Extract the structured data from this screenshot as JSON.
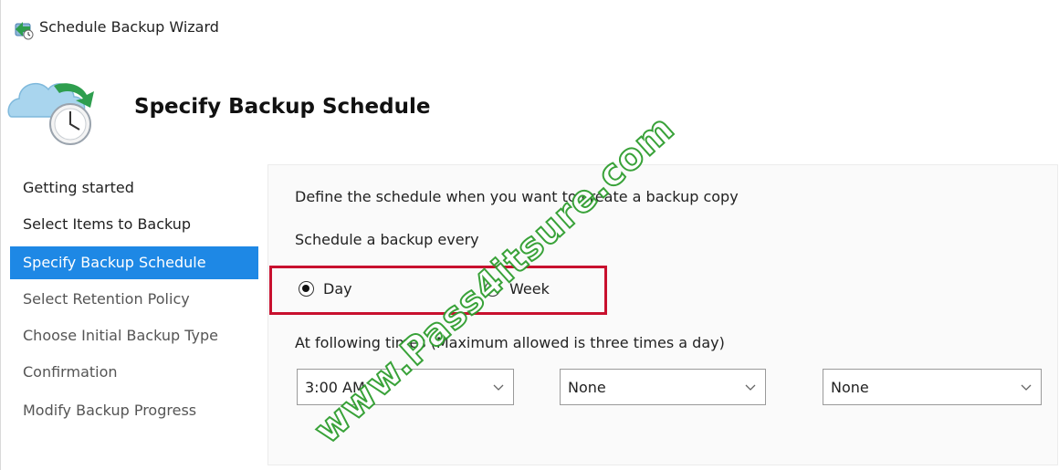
{
  "window": {
    "title": "Schedule Backup Wizard"
  },
  "header": {
    "heading": "Specify Backup Schedule"
  },
  "nav": {
    "items": [
      {
        "label": "Getting started"
      },
      {
        "label": "Select Items to Backup"
      },
      {
        "label": "Specify Backup Schedule"
      },
      {
        "label": "Select Retention Policy"
      },
      {
        "label": "Choose Initial Backup Type"
      },
      {
        "label": "Confirmation"
      },
      {
        "label": "Modify Backup Progress"
      }
    ],
    "active_index": 2
  },
  "content": {
    "define_text": "Define the schedule when you want to create a backup copy",
    "schedule_label": "Schedule a backup every",
    "radios": {
      "day": "Day",
      "week": "Week",
      "selected": "day"
    },
    "times_label": "At following times (Maximum allowed is three times a day)",
    "times": [
      "3:00 AM",
      "None",
      "None"
    ]
  },
  "watermark": {
    "text": "www.Pass4itsure.com"
  },
  "colors": {
    "accent": "#1e88e5",
    "highlight_box": "#c8102e",
    "watermark": "#2f9e2f"
  },
  "icons": {
    "app": "backup-wizard-icon",
    "header": "cloud-clock-backup-icon",
    "chevron": "chevron-down-icon"
  }
}
